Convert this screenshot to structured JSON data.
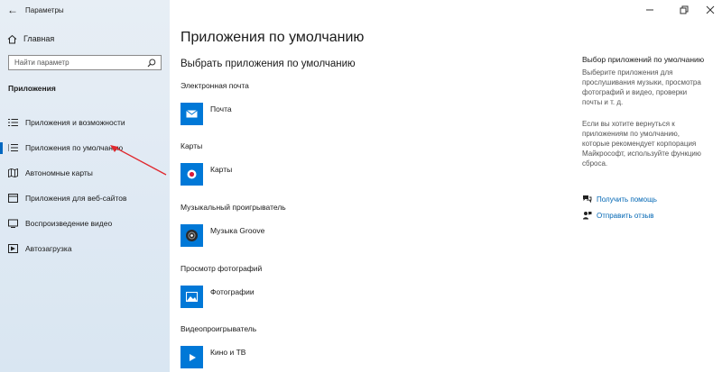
{
  "window": {
    "title": "Параметры",
    "back_icon": "back-arrow-icon",
    "controls": [
      "minimize-icon",
      "restore-icon",
      "close-icon"
    ]
  },
  "sidebar": {
    "home_label": "Главная",
    "search_placeholder": "Найти параметр",
    "section_title": "Приложения",
    "items": [
      {
        "label": "Приложения и возможности",
        "icon": "list-icon",
        "active": false
      },
      {
        "label": "Приложения по умолчанию",
        "icon": "default-apps-icon",
        "active": true
      },
      {
        "label": "Автономные карты",
        "icon": "map-icon",
        "active": false
      },
      {
        "label": "Приложения для веб-сайтов",
        "icon": "web-apps-icon",
        "active": false
      },
      {
        "label": "Воспроизведение видео",
        "icon": "video-icon",
        "active": false
      },
      {
        "label": "Автозагрузка",
        "icon": "startup-icon",
        "active": false
      }
    ]
  },
  "main": {
    "title": "Приложения по умолчанию",
    "subtitle": "Выбрать приложения по умолчанию",
    "groups": [
      {
        "category": "Электронная почта",
        "app": "Почта",
        "icon": "mail-app-icon"
      },
      {
        "category": "Карты",
        "app": "Карты",
        "icon": "maps-app-icon"
      },
      {
        "category": "Музыкальный проигрыватель",
        "app": "Музыка Groove",
        "icon": "groove-music-icon"
      },
      {
        "category": "Просмотр фотографий",
        "app": "Фотографии",
        "icon": "photos-app-icon"
      },
      {
        "category": "Видеопроигрыватель",
        "app": "Кино и ТВ",
        "icon": "movies-tv-icon"
      }
    ]
  },
  "right": {
    "title": "Выбор приложений по умолчанию",
    "para1_lines": [
      "Выберите приложения для",
      "прослушивания музыки, просмотра",
      "фотографий и видео, проверки",
      "почты и т. д."
    ],
    "para2_lines": [
      "Если вы хотите вернуться к",
      "приложениям по умолчанию,",
      "которые рекомендует корпорация",
      "Майкрософт, используйте функцию",
      "сброса."
    ],
    "help_link": "Получить помощь",
    "feedback_link": "Отправить отзыв"
  },
  "colors": {
    "accent": "#0067c0",
    "tile": "#0078d7",
    "link": "#0066b4",
    "annotation": "#e0282e"
  }
}
